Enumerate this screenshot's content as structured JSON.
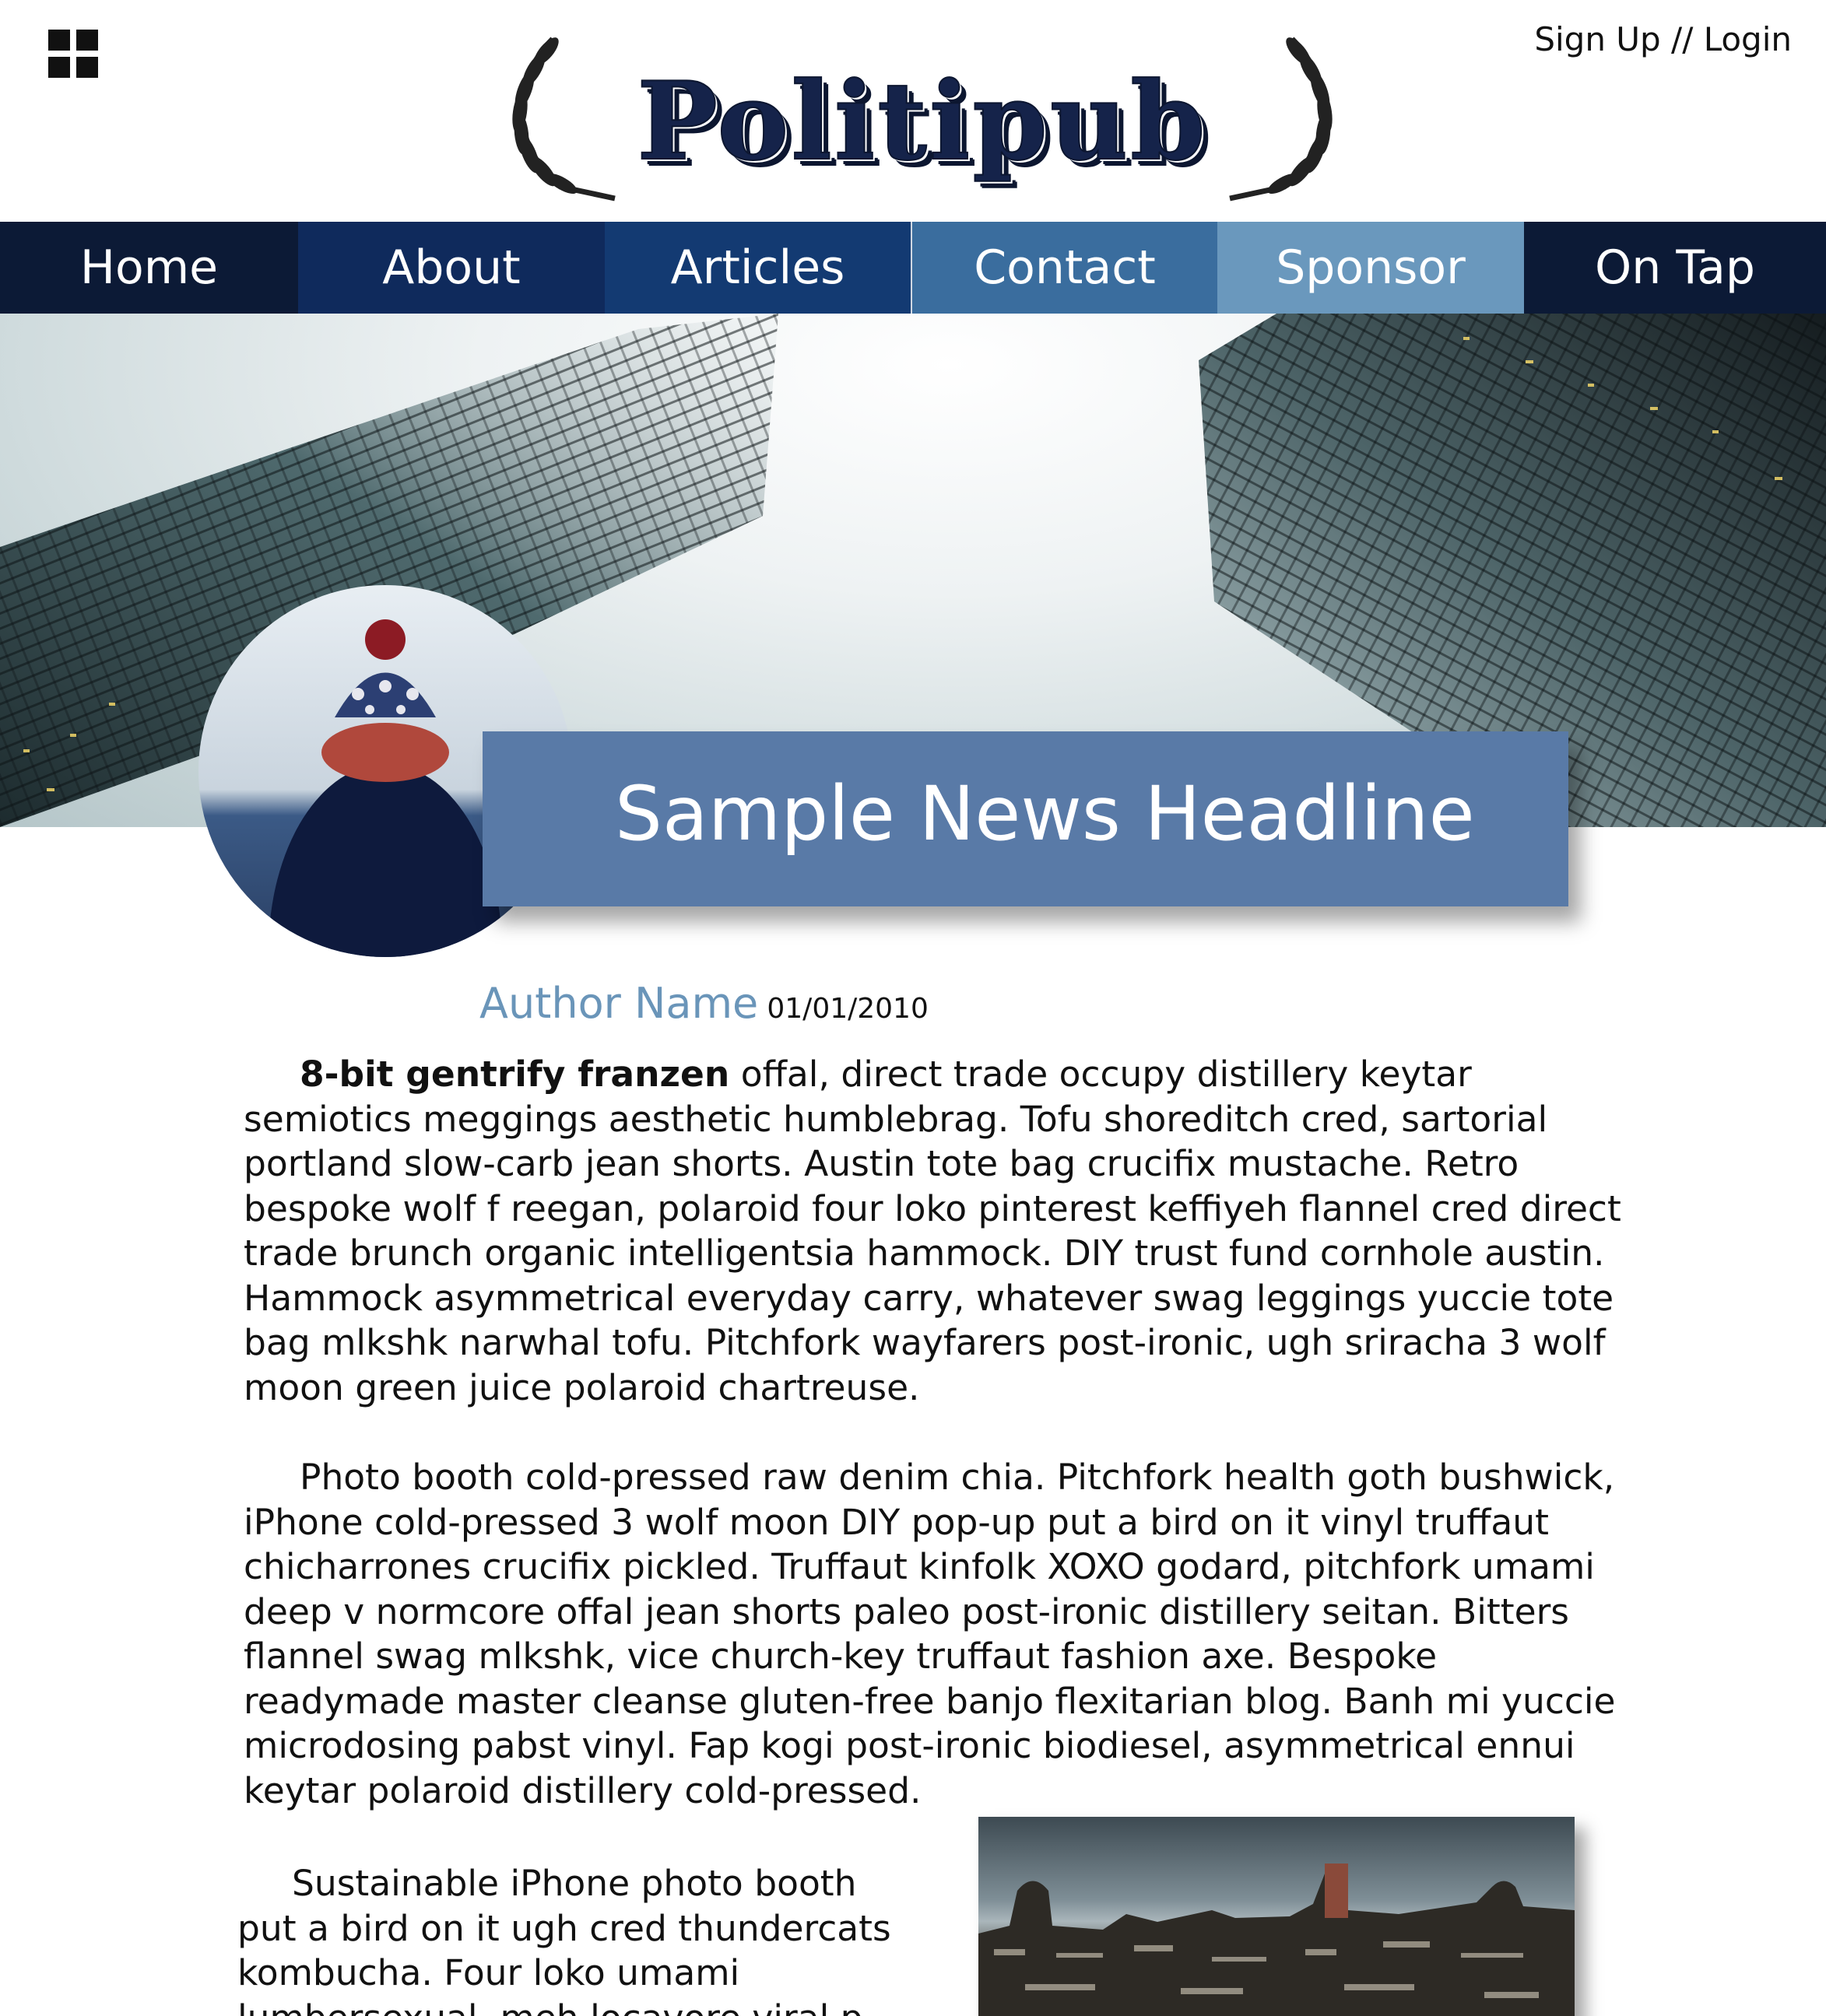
{
  "header": {
    "menu_icon": "grid-menu-icon",
    "logo_text": "Politipub",
    "auth_link": "Sign Up // Login"
  },
  "nav": {
    "items": [
      "Home",
      "About",
      "Articles",
      "Contact",
      "Sponsor",
      "On Tap"
    ]
  },
  "article": {
    "headline": "Sample News Headline",
    "author": "Author Name",
    "date": "01/01/2010",
    "p1_lead": "8-bit gentrify franzen",
    "p1_rest": " offal, direct trade occupy distillery keytar semiotics meggings aesthetic humblebrag. Tofu shoreditch cred, sartorial portland slow-carb jean shorts. Austin tote bag crucifix mustache. Retro bespoke wolf f reegan, polaroid four loko pinterest keffiyeh flannel cred direct trade brunch organic intelligentsia hammock. DIY trust fund cornhole austin. Hammock asymmetrical everyday carry, whatever swag leggings yuccie tote bag mlkshk narwhal tofu. Pitchfork wayfarers post-ironic, ugh sriracha 3 wolf moon green juice polaroid chartreuse.",
    "p2": "Photo booth cold-pressed raw denim chia. Pitchfork health goth bushwick, iPhone cold-pressed 3 wolf moon DIY pop-up put a bird on it vinyl truffaut chicharrones crucifix pickled. Truffaut kinfolk XOXO godard, pitchfork umami deep v normcore offal jean shorts paleo post-ironic distillery seitan. Bitters flannel swag mlkshk, vice church-key truffaut fashion axe. Bespoke readymade master cleanse gluten-free banjo flexitarian blog. Banh mi yuccie microdosing pabst vinyl. Fap kogi post-ironic biodiesel, asymmetrical ennui keytar polaroid distillery cold-pressed.",
    "p3": "Sustainable iPhone photo booth put a bird on it ugh cred thundercats kombucha. Four loko umami lumbersexual, meh locavore viral p"
  }
}
